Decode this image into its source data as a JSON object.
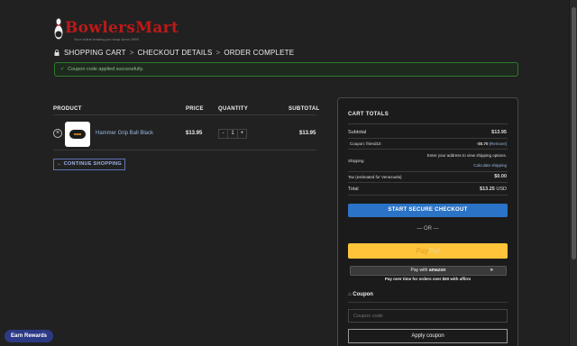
{
  "brand": {
    "name_part1": "Bowlers",
    "name_part2": "Mart",
    "tagline": "Your online bowling pro shop since 1999"
  },
  "breadcrumb": {
    "step1": "SHOPPING CART",
    "step2": "CHECKOUT DETAILS",
    "step3": "ORDER COMPLETE",
    "separator": ">"
  },
  "notice": {
    "icon": "check-icon",
    "text": "Coupon code applied successfully."
  },
  "cart": {
    "headers": {
      "product": "PRODUCT",
      "price": "PRICE",
      "quantity": "QUANTITY",
      "subtotal": "SUBTOTAL"
    },
    "items": [
      {
        "name": "Hammer Grip Ball Black",
        "price": "$13.95",
        "quantity": "1",
        "subtotal": "$13.95",
        "remove_symbol": "×",
        "minus": "-",
        "plus": "+"
      }
    ],
    "continue_label": "← CONTINUE SHOPPING"
  },
  "totals": {
    "heading": "CART TOTALS",
    "subtotal_label": "Subtotal",
    "subtotal_value": "$13.95",
    "coupon_label": "Coupon: friend10",
    "coupon_value": "-$0.70",
    "coupon_remove": "[Remove]",
    "shipping_label": "Shipping",
    "shipping_note": "Enter your address to view shipping options.",
    "shipping_link": "Calculate shipping",
    "tax_label": "Tax (estimated for Venezuela)",
    "tax_value": "$0.00",
    "total_label": "Total",
    "total_value": "$13.25",
    "total_currency": "USD",
    "checkout_label": "START SECURE CHECKOUT",
    "or_label": "— OR —",
    "paypal_part1": "Pay",
    "paypal_part2": "Pal",
    "amazon_prefix": "Pay with",
    "amazon_brand": "amazon",
    "amazon_arrow": "»",
    "affirm_text": "Pay over time for orders over $50 with affirm",
    "coupon_heading": "Coupon",
    "coupon_placeholder": "Coupon code",
    "apply_label": "Apply coupon"
  },
  "rewards": {
    "label": "Earn Rewards"
  },
  "colors": {
    "background": "#212121",
    "accent_blue": "#2b73c6",
    "paypal_yellow": "#ffc439",
    "success_green": "#2f7a2f",
    "brand_red": "#c01818",
    "rewards_blue": "#2c3a86"
  }
}
